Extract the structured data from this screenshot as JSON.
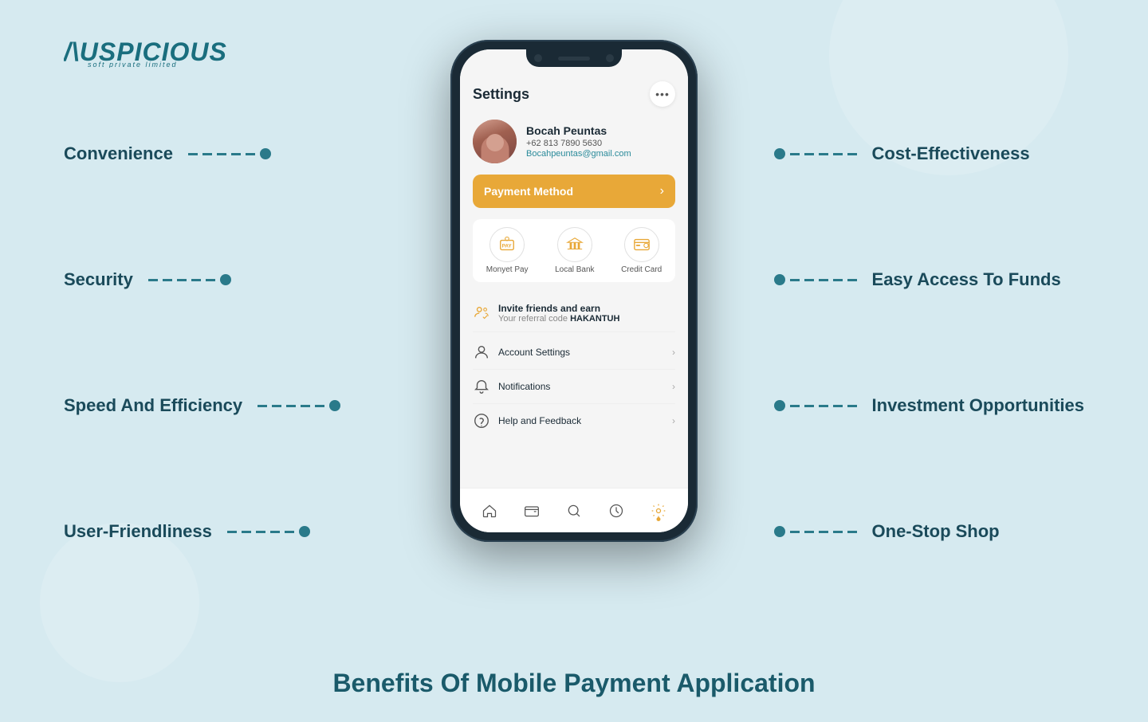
{
  "logo": {
    "text": "AUSPICIOUS",
    "sub": "soft private limited"
  },
  "left_labels": [
    {
      "id": "convenience",
      "text": "Convenience"
    },
    {
      "id": "security",
      "text": "Security"
    },
    {
      "id": "speed",
      "text": "Speed And Efficiency"
    },
    {
      "id": "friendliness",
      "text": "User-Friendliness"
    }
  ],
  "right_labels": [
    {
      "id": "cost",
      "text": "Cost-Effectiveness"
    },
    {
      "id": "access",
      "text": "Easy Access To Funds"
    },
    {
      "id": "investment",
      "text": "Investment Opportunities"
    },
    {
      "id": "shop",
      "text": "One-Stop Shop"
    }
  ],
  "phone": {
    "header": {
      "title": "Settings",
      "menu_label": "..."
    },
    "profile": {
      "name": "Bocah Peuntas",
      "phone": "+62 813 7890 5630",
      "email": "Bocahpeuntas@gmail.com"
    },
    "payment_method": {
      "label": "Payment Method",
      "arrow": "›"
    },
    "payment_icons": [
      {
        "id": "monyet-pay",
        "label": "Monyet Pay"
      },
      {
        "id": "local-bank",
        "label": "Local Bank"
      },
      {
        "id": "credit-card",
        "label": "Credit Card"
      }
    ],
    "invite": {
      "title": "Invite friends and earn",
      "subtitle_prefix": "Your referral code ",
      "code": "HAKANTUH"
    },
    "menu_items": [
      {
        "id": "account-settings",
        "label": "Account Settings"
      },
      {
        "id": "notifications",
        "label": "Notifications"
      },
      {
        "id": "help-feedback",
        "label": "Help and Feedback"
      }
    ],
    "nav_items": [
      {
        "id": "home",
        "icon": "home"
      },
      {
        "id": "wallet",
        "icon": "wallet"
      },
      {
        "id": "search",
        "icon": "search"
      },
      {
        "id": "history",
        "icon": "history"
      },
      {
        "id": "settings",
        "icon": "settings",
        "active": true
      }
    ]
  },
  "bottom_heading": "Benefits Of Mobile Payment Application",
  "colors": {
    "teal": "#1a6e7e",
    "orange": "#e8a838",
    "dark": "#1a2a35",
    "bg": "#d6eaf0"
  }
}
